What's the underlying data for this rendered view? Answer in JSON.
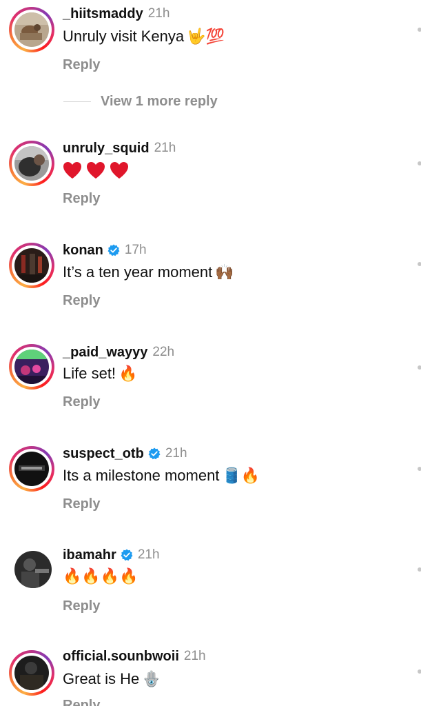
{
  "comments": [
    {
      "username": "_hiitsmaddy",
      "time": "21h",
      "text": "Unruly visit Kenya",
      "emojis": "🤟💯",
      "reply_label": "Reply",
      "avatar_icon": "avatar-photo"
    },
    {
      "username": "unruly_squid",
      "time": "21h",
      "text": "",
      "emojis": "❤️❤️❤️",
      "reply_label": "Reply",
      "avatar_icon": "avatar-photo"
    },
    {
      "username": "konan",
      "time": "17h",
      "verified": true,
      "text": "It’s a ten year moment",
      "emojis": "🙌🏾",
      "reply_label": "Reply",
      "avatar_icon": "avatar-photo"
    },
    {
      "username": "_paid_wayyy",
      "time": "22h",
      "text": "Life set!",
      "emojis": "🔥",
      "reply_label": "Reply",
      "avatar_icon": "avatar-photo"
    },
    {
      "username": "suspect_otb",
      "time": "21h",
      "verified": true,
      "text": "Its a milestone moment",
      "emojis": "🛢️🔥",
      "reply_label": "Reply",
      "avatar_icon": "avatar-photo"
    },
    {
      "username": "ibamahr",
      "time": "21h",
      "verified": true,
      "text": "",
      "emojis": "🔥🔥🔥🔥",
      "reply_label": "Reply",
      "avatar_icon": "avatar-photo"
    },
    {
      "username": "official.sounbwoii",
      "time": "21h",
      "text": "Great is He",
      "emojis": "🪬",
      "reply_label": "Reply",
      "avatar_icon": "avatar-photo"
    }
  ],
  "view_more": {
    "label": "View 1 more reply"
  },
  "colors": {
    "verified_blue": "#1d9bf0",
    "secondary_text": "#8e8e8e",
    "heart_red": "#e0162b"
  }
}
